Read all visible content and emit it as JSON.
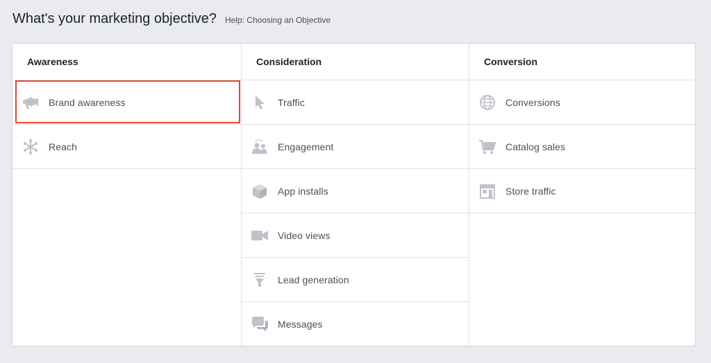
{
  "header": {
    "title": "What's your marketing objective?",
    "help_link": "Help: Choosing an Objective"
  },
  "colors": {
    "selected_border": "#e9472d",
    "icon": "#bec2c9",
    "label": "#4b4f56"
  },
  "columns": [
    {
      "title": "Awareness",
      "items": [
        {
          "label": "Brand awareness",
          "icon": "megaphone-icon",
          "selected": true
        },
        {
          "label": "Reach",
          "icon": "reach-icon",
          "selected": false
        }
      ]
    },
    {
      "title": "Consideration",
      "items": [
        {
          "label": "Traffic",
          "icon": "cursor-icon"
        },
        {
          "label": "Engagement",
          "icon": "people-icon"
        },
        {
          "label": "App installs",
          "icon": "box-icon"
        },
        {
          "label": "Video views",
          "icon": "video-camera-icon"
        },
        {
          "label": "Lead generation",
          "icon": "funnel-icon"
        },
        {
          "label": "Messages",
          "icon": "chat-bubbles-icon"
        }
      ]
    },
    {
      "title": "Conversion",
      "items": [
        {
          "label": "Conversions",
          "icon": "globe-icon"
        },
        {
          "label": "Catalog sales",
          "icon": "shopping-cart-icon"
        },
        {
          "label": "Store traffic",
          "icon": "storefront-icon"
        }
      ]
    }
  ]
}
